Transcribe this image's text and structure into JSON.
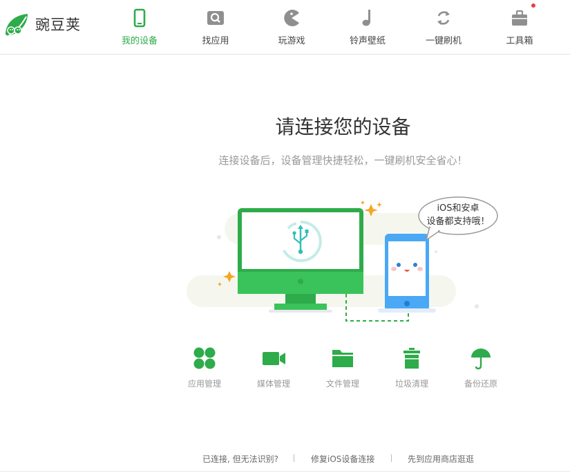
{
  "app": {
    "logo_text": "豌豆荚"
  },
  "nav": [
    {
      "label": "我的设备",
      "icon": "phone-icon",
      "active": true
    },
    {
      "label": "找应用",
      "icon": "search-app-icon"
    },
    {
      "label": "玩游戏",
      "icon": "pacman-icon"
    },
    {
      "label": "铃声壁纸",
      "icon": "music-note-icon"
    },
    {
      "label": "一键刷机",
      "icon": "refresh-icon"
    },
    {
      "label": "工具箱",
      "icon": "toolbox-icon",
      "badge": true
    }
  ],
  "main": {
    "title": "请连接您的设备",
    "subtitle": "连接设备后，设备管理快捷轻松，一键刷机安全省心！",
    "speech_bubble": [
      "iOS和安卓",
      "设备都支持哦！"
    ]
  },
  "features": [
    {
      "label": "应用管理",
      "icon": "apps-grid-icon"
    },
    {
      "label": "媒体管理",
      "icon": "video-camera-icon"
    },
    {
      "label": "文件管理",
      "icon": "folder-icon"
    },
    {
      "label": "垃圾清理",
      "icon": "trash-icon"
    },
    {
      "label": "备份还原",
      "icon": "umbrella-icon"
    }
  ],
  "footer": {
    "links": [
      "已连接, 但无法识别?",
      "修复iOS设备连接",
      "先到应用商店逛逛"
    ]
  },
  "colors": {
    "accent": "#2eab4a",
    "monitor_green": "#3ac35a",
    "phone_blue": "#4aa8f5",
    "badge_red": "#ee3a4a",
    "muted_text": "#999999"
  }
}
